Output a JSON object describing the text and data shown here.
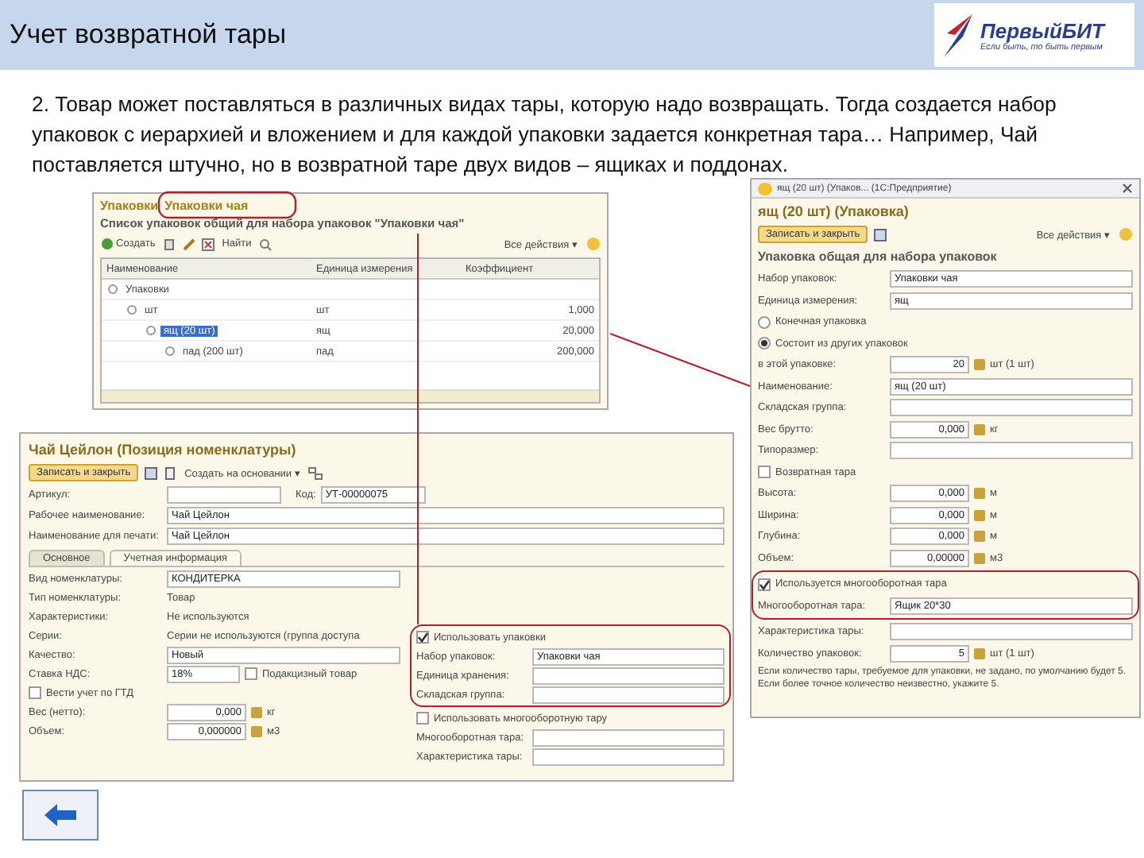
{
  "slide": {
    "title": "Учет возвратной тары",
    "logo": {
      "name": "ПервыйБИТ",
      "tagline": "Если быть, то быть первым"
    },
    "paragraph": "2. Товар может поставляться в различных видах тары, которую надо возвращать. Тогда создается набор упаковок с иерархией и вложением и для каждой упаковки задается конкретная тара… Например, Чай поставляется штучно, но в возвратной таре двух видов – ящиках  и поддонах."
  },
  "packages_list": {
    "breadcrumbs": [
      "Упаковки",
      "Упаковки чая"
    ],
    "subtitle": "Список упаковок общий для набора упаковок \"Упаковки чая\"",
    "toolbar": {
      "create": "Создать",
      "find": "Найти",
      "all_actions": "Все действия ▾"
    },
    "columns": [
      "Наименование",
      "Единица измерения",
      "Коэффициент"
    ],
    "rows": [
      {
        "name": "Упаковки",
        "selected": false,
        "children": [
          {
            "name": "шт",
            "unit": "шт",
            "coefficient": "1,000",
            "selected": false,
            "children": [
              {
                "name": "ящ (20 шт)",
                "unit": "ящ",
                "coefficient": "20,000",
                "selected": true,
                "children": [
                  {
                    "name": "пад (200 шт)",
                    "unit": "пад",
                    "coefficient": "200,000",
                    "selected": false
                  }
                ]
              }
            ]
          }
        ]
      }
    ]
  },
  "item_card": {
    "title": "Чай Цейлон (Позиция номенклатуры)",
    "save_button": "Записать и закрыть",
    "create_based_on": "Создать на основании ▾",
    "article_label": "Артикул:",
    "code_label": "Код:",
    "code": "УТ-00000075",
    "header_fields": [
      {
        "kind": "field",
        "label": "Рабочее наименование:",
        "value": "Чай Цейлон"
      },
      {
        "kind": "field",
        "label": "Наименование для печати:",
        "value": "Чай Цейлон"
      }
    ],
    "tabs": [
      {
        "label": "Основное",
        "selected": false
      },
      {
        "label": "Учетная информация",
        "selected": true
      }
    ],
    "left_fields": [
      {
        "kind": "field",
        "label": "Вид номенклатуры:",
        "value": "КОНДИТЕРКА"
      },
      {
        "kind": "text",
        "label": "Тип номенклатуры:",
        "value": "Товар"
      },
      {
        "kind": "text",
        "label": "Характеристики:",
        "value": "Не используются"
      },
      {
        "kind": "text",
        "label": "Серии:",
        "value": "Серии не используются (группа доступа"
      },
      {
        "kind": "field",
        "label": "Качество:",
        "value": "Новый"
      },
      {
        "kind": "field",
        "label": "Ставка НДС:",
        "value": "18%",
        "extra": "Подакцизный товар",
        "extra_checked": false
      },
      {
        "kind": "check",
        "label": "Вести учет по ГТД",
        "checked": false
      },
      {
        "kind": "number",
        "label": "Вес (нетто):",
        "value": "0,000",
        "unit": "кг"
      },
      {
        "kind": "number",
        "label": "Объем:",
        "value": "0,000000",
        "unit": "м3"
      }
    ],
    "right_fields": [
      {
        "kind": "check",
        "label": "Использовать упаковки",
        "checked": true
      },
      {
        "kind": "field",
        "label": "Набор упаковок:",
        "value": "Упаковки чая"
      },
      {
        "kind": "field",
        "label": "Единица хранения:"
      },
      {
        "kind": "field",
        "label": "Складская группа:"
      },
      {
        "kind": "check",
        "label": "Использовать многооборотную тару",
        "checked": false
      },
      {
        "kind": "field",
        "label": "Многооборотная тара:"
      },
      {
        "kind": "field",
        "label": "Характеристика тары:"
      }
    ]
  },
  "package_form": {
    "window_title": "ящ (20 шт) (Упаков... (1С:Предприятие)",
    "title": "ящ (20 шт) (Упаковка)",
    "save_button": "Записать и закрыть",
    "all_actions": "Все действия ▾",
    "section": "Упаковка общая для набора упаковок",
    "fields": [
      {
        "kind": "field",
        "label": "Набор упаковок:",
        "value": "Упаковки чая"
      },
      {
        "kind": "field",
        "label": "Единица измерения:",
        "value": "ящ"
      },
      {
        "kind": "radio",
        "label": "Конечная упаковка",
        "selected": false
      },
      {
        "kind": "radio",
        "label": "Состоит из других упаковок",
        "selected": true
      },
      {
        "kind": "number",
        "label": "в этой упаковке:",
        "value": "20",
        "unit": "шт (1 шт)"
      },
      {
        "kind": "field",
        "label": "Наименование:",
        "value": "ящ (20 шт)"
      },
      {
        "kind": "field",
        "label": "Складская группа:"
      },
      {
        "kind": "number",
        "label": "Вес брутто:",
        "value": "0,000",
        "unit": "кг"
      },
      {
        "kind": "field",
        "label": "Типоразмер:"
      },
      {
        "kind": "check",
        "label": "Возвратная тара",
        "checked": false
      },
      {
        "kind": "number",
        "label": "Высота:",
        "value": "0,000",
        "unit": "м"
      },
      {
        "kind": "number",
        "label": "Ширина:",
        "value": "0,000",
        "unit": "м"
      },
      {
        "kind": "number",
        "label": "Глубина:",
        "value": "0,000",
        "unit": "м"
      },
      {
        "kind": "number",
        "label": "Объем:",
        "value": "0,00000",
        "unit": "м3"
      },
      {
        "kind": "check",
        "label": "Используется многооборотная тара",
        "checked": true
      },
      {
        "kind": "field",
        "label": "Многооборотная тара:",
        "value": "Ящик 20*30"
      },
      {
        "kind": "field",
        "label": "Характеристика тары:"
      },
      {
        "kind": "number",
        "label": "Количество упаковок:",
        "value": "5",
        "unit": "шт (1 шт)"
      }
    ],
    "note": "Если количество тары, требуемое для упаковки, не задано, по умолчанию будет 5. Если более точное количество неизвестно, укажите 5."
  }
}
